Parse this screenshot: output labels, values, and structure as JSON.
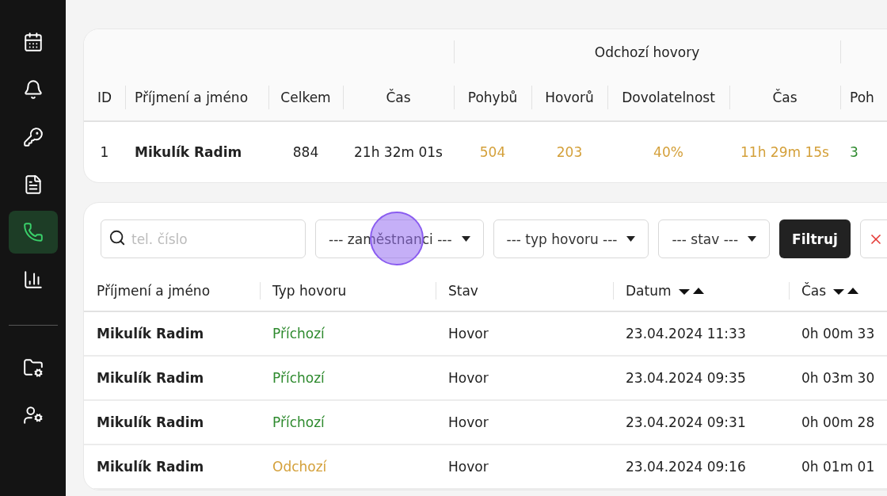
{
  "sidebar": {
    "items": [
      {
        "selected": false
      },
      {
        "selected": false
      },
      {
        "selected": false
      },
      {
        "selected": false
      },
      {
        "selected": true
      },
      {
        "selected": false
      }
    ],
    "bottom_items": [
      {
        "selected": false
      },
      {
        "selected": false
      }
    ]
  },
  "summary": {
    "group_label": "Odchozí hovory",
    "columns": [
      "ID",
      "Příjmení a jméno",
      "Celkem",
      "Čas",
      "Pohybů",
      "Hovorů",
      "Dovolatelnost",
      "Čas",
      "Poh"
    ],
    "rows": [
      {
        "cells": [
          {
            "text": "1",
            "kind": "plain"
          },
          {
            "text": "Mikulík Radim",
            "kind": "plain"
          },
          {
            "text": "884",
            "kind": "plain"
          },
          {
            "text": "21h 32m 01s",
            "kind": "plain"
          },
          {
            "text": "504",
            "kind": "outgoing"
          },
          {
            "text": "203",
            "kind": "outgoing"
          },
          {
            "text": "40%",
            "kind": "outgoing"
          },
          {
            "text": "11h 29m 15s",
            "kind": "outgoing"
          },
          {
            "text": "3",
            "kind": "incoming"
          }
        ]
      }
    ]
  },
  "filters": {
    "search": {
      "placeholder": "tel. číslo"
    },
    "selects": [
      "--- zaměstnanci ---",
      "--- typ hovoru ---",
      "--- stav ---"
    ],
    "submit": "Filtruj"
  },
  "calls": {
    "columns": [
      {
        "label": "Příjmení a jméno",
        "sortable": false
      },
      {
        "label": "Typ hovoru",
        "sortable": false
      },
      {
        "label": "Stav",
        "sortable": false
      },
      {
        "label": "Datum",
        "sortable": true
      },
      {
        "label": "Čas",
        "sortable": true
      }
    ],
    "rows": [
      {
        "name": "Mikulík Radim",
        "type": "Příchozí",
        "kind": "incoming",
        "status": "Hovor",
        "date": "23.04.2024 11:33",
        "time": "0h 00m 33"
      },
      {
        "name": "Mikulík Radim",
        "type": "Příchozí",
        "kind": "incoming",
        "status": "Hovor",
        "date": "23.04.2024 09:35",
        "time": "0h 03m 30"
      },
      {
        "name": "Mikulík Radim",
        "type": "Příchozí",
        "kind": "incoming",
        "status": "Hovor",
        "date": "23.04.2024 09:31",
        "time": "0h 00m 28"
      },
      {
        "name": "Mikulík Radim",
        "type": "Odchozí",
        "kind": "outgoing",
        "status": "Hovor",
        "date": "23.04.2024 09:16",
        "time": "0h 01m 01"
      }
    ]
  }
}
